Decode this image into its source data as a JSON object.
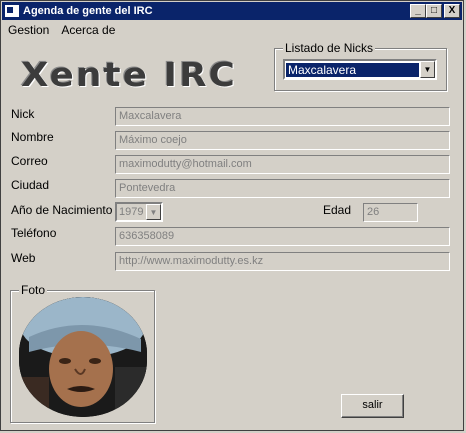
{
  "window": {
    "title": "Agenda de gente del IRC",
    "min_glyph": "_",
    "max_glyph": "□",
    "close_glyph": "X"
  },
  "menu": {
    "items": [
      "Gestion",
      "Acerca de"
    ]
  },
  "logo_text": "Xente IRC",
  "nicks": {
    "group_label": "Listado de Nicks",
    "selected": "Maxcalavera"
  },
  "form": {
    "nick": {
      "label": "Nick",
      "value": "Maxcalavera"
    },
    "nombre": {
      "label": "Nombre",
      "value": "Máximo coejo"
    },
    "correo": {
      "label": "Correo",
      "value": "maximodutty@hotmail.com"
    },
    "ciudad": {
      "label": "Ciudad",
      "value": "Pontevedra"
    },
    "nacimiento": {
      "label": "Año de Nacimiento",
      "value": "1979"
    },
    "edad": {
      "label": "Edad",
      "value": "26"
    },
    "telefono": {
      "label": "Teléfono",
      "value": "636358089"
    },
    "web": {
      "label": "Web",
      "value": "http://www.maximodutty.es.kz"
    }
  },
  "foto": {
    "group_label": "Foto"
  },
  "salir_label": "salir",
  "colors": {
    "titlebar": "#0a246a",
    "face": "#d4d0c8",
    "disabled_text": "#808080"
  }
}
